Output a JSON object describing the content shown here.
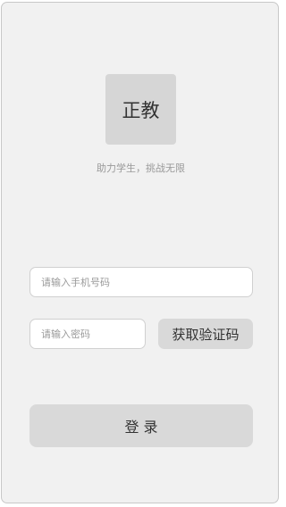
{
  "logo": {
    "text": "正教"
  },
  "slogan": "助力学生，挑战无限",
  "phone_input": {
    "value": "",
    "placeholder": "请输入手机号码"
  },
  "password_input": {
    "value": "",
    "placeholder": "请输入密码"
  },
  "get_code_button": {
    "label": "获取验证码"
  },
  "login_button": {
    "label": "登 录"
  },
  "colors": {
    "screen_background": "#f1f1f1",
    "logo_background": "#d6d6d6",
    "button_background": "#d9d9d9",
    "input_border": "#d0d0d0",
    "slogan_text": "#999999"
  }
}
